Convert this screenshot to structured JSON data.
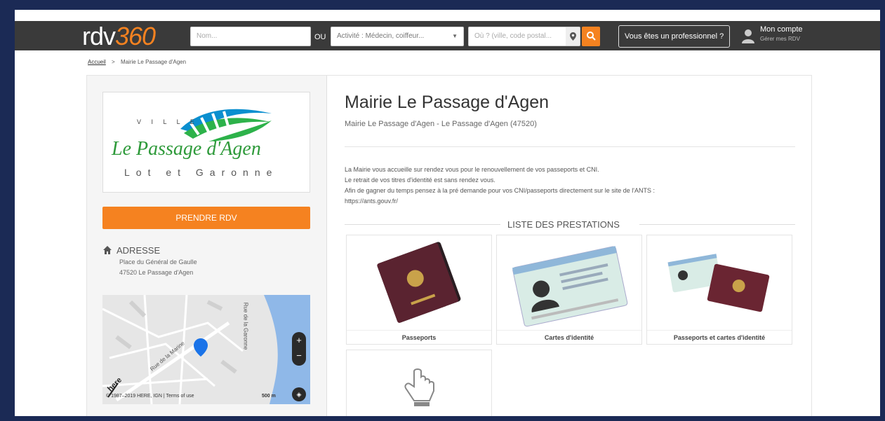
{
  "header": {
    "logo_text": "rdv",
    "logo_number": "360",
    "search_name_placeholder": "Nom...",
    "or_label": "OU",
    "activity_placeholder": "Activité : Médecin, coiffeur...",
    "location_placeholder": "Où ? (ville, code postal...",
    "pro_button": "Vous êtes un professionnel ?",
    "account_title": "Mon compte",
    "account_sub": "Gérer mes RDV"
  },
  "breadcrumb": {
    "home": "Accueil",
    "separator": ">",
    "current": "Mairie Le Passage d'Agen"
  },
  "sidebar": {
    "logo": {
      "ville": "V I L L E",
      "name": "Le Passage d'Agen",
      "region": "Lot et Garonne"
    },
    "book_button": "PRENDRE RDV",
    "address_title": "ADRESSE",
    "address_line1": "Place du Général de Gaulle",
    "address_line2": "47520 Le Passage d'Agen",
    "map": {
      "street1": "Rue de la Marine",
      "street2": "Rue de la Garonne",
      "copyright": "© 1987–2019 HERE, IGN | Terms of use",
      "scale": "500 m",
      "zoom_in": "+",
      "zoom_out": "−",
      "brand": "here"
    }
  },
  "main": {
    "title": "Mairie Le Passage d'Agen",
    "subtitle": "Mairie Le Passage d'Agen - Le Passage d'Agen (47520)",
    "description": [
      "La Mairie vous accueille sur rendez vous pour le renouvellement de vos passeports et CNI.",
      "Le retrait de vos titres d'identité est sans rendez vous.",
      "Afin de gagner du temps pensez à la pré demande pour vos CNI/passeports directement sur le site de l'ANTS :",
      "https://ants.gouv.fr/"
    ],
    "services_title": "LISTE DES PRESTATIONS",
    "services": [
      {
        "label": "Passeports"
      },
      {
        "label": "Cartes d'identité"
      },
      {
        "label": "Passeports et cartes d'identité"
      },
      {
        "label": ""
      }
    ]
  },
  "colors": {
    "accent": "#f58220",
    "header_bg": "#3a3a3a",
    "frame": "#1b2a55"
  }
}
